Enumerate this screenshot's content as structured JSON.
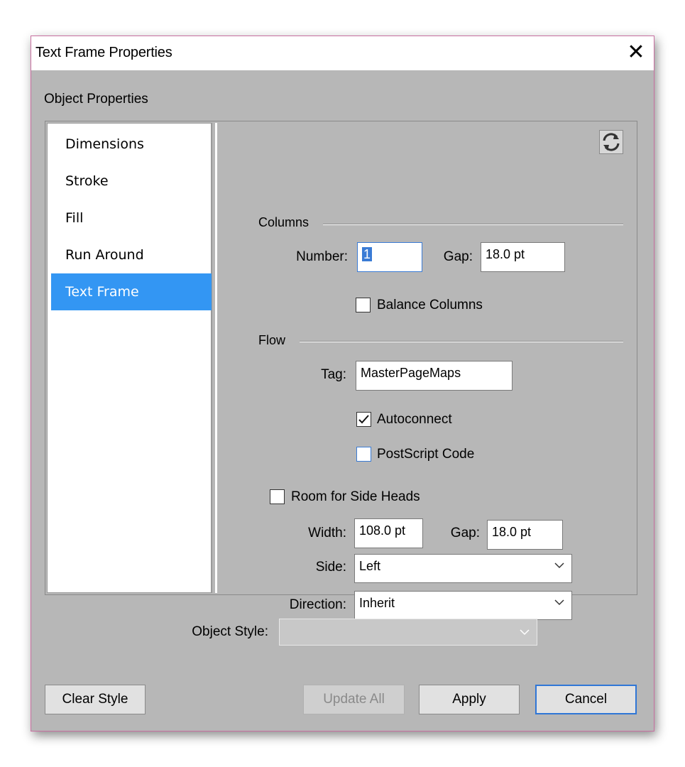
{
  "window": {
    "title": "Text Frame Properties",
    "close_glyph": "✕"
  },
  "section_label": "Object Properties",
  "nav": {
    "items": [
      {
        "label": "Dimensions"
      },
      {
        "label": "Stroke"
      },
      {
        "label": "Fill"
      },
      {
        "label": "Run Around"
      },
      {
        "label": "Text Frame"
      }
    ],
    "selected": "Text Frame"
  },
  "columns": {
    "group_label": "Columns",
    "number_label": "Number:",
    "number_value": "1",
    "gap_label": "Gap:",
    "gap_value": "18.0 pt",
    "balance_label": "Balance Columns",
    "balance_checked": false
  },
  "flow": {
    "group_label": "Flow",
    "tag_label": "Tag:",
    "tag_value": "MasterPageMaps",
    "autoconnect_label": "Autoconnect",
    "autoconnect_checked": true,
    "postscript_label": "PostScript Code",
    "postscript_checked": false
  },
  "side_heads": {
    "room_label": "Room for Side Heads",
    "room_checked": false,
    "width_label": "Width:",
    "width_value": "108.0 pt",
    "gap_label": "Gap:",
    "gap_value": "18.0 pt",
    "side_label": "Side:",
    "side_value": "Left",
    "direction_label": "Direction:",
    "direction_value": "Inherit"
  },
  "object_style": {
    "label": "Object Style:",
    "value": ""
  },
  "buttons": {
    "clear_style": "Clear Style",
    "update_all": "Update All",
    "apply": "Apply",
    "cancel": "Cancel"
  },
  "colors": {
    "dialog_bg": "#b7b7b7",
    "selection": "#3396f3",
    "focus": "#3a7bd5",
    "window_border": "#c86fa0"
  }
}
